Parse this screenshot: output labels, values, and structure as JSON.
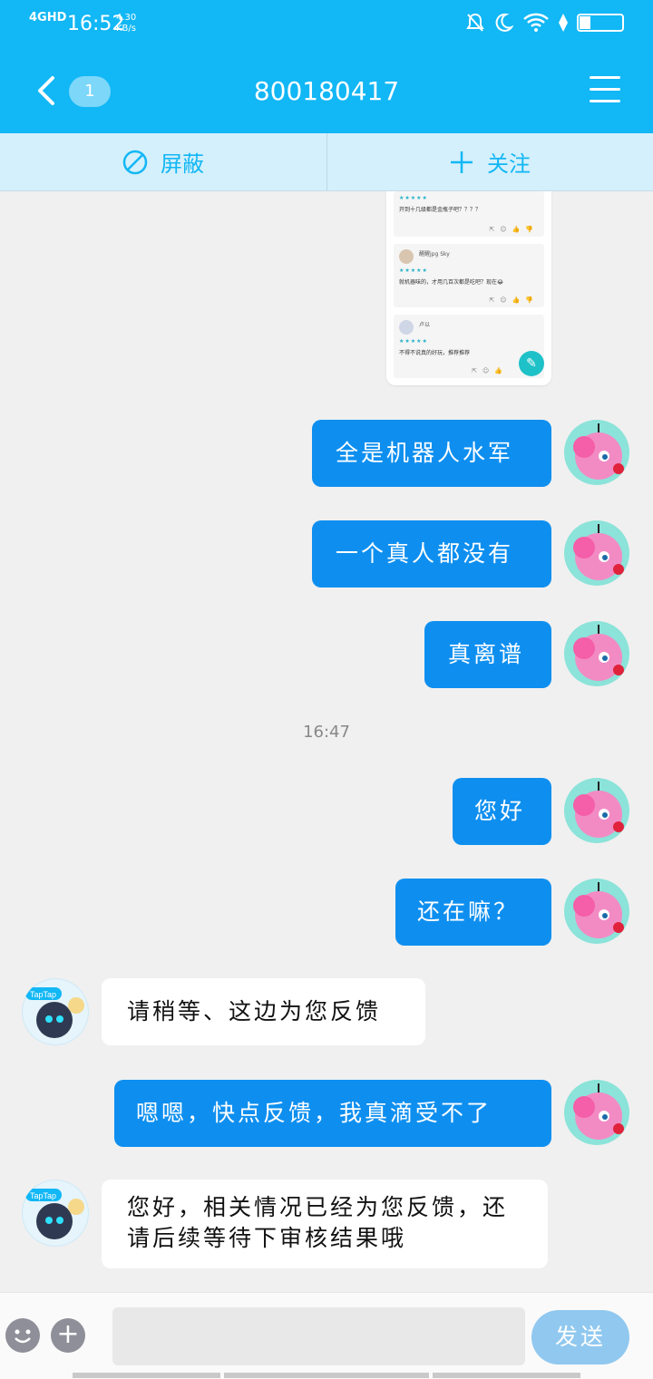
{
  "status": {
    "network": "4GHD",
    "time": "16:52",
    "speed_value": "4.30",
    "speed_unit": "KB/s",
    "battery": "27"
  },
  "header": {
    "title": "800180417",
    "unread_count": "1"
  },
  "actions": {
    "block_label": "屏蔽",
    "follow_label": "关注"
  },
  "screenshot_preview": {
    "cards": [
      {
        "name": "",
        "stars": "★★★★★",
        "text": "开到十几级都是金瓶子吧？？？？"
      },
      {
        "name": "醒醒jpg Sky",
        "stars": "★★★★★",
        "text": "就机器味的，才用几百次都是吃吧？现在😂"
      },
      {
        "name": "卢以",
        "stars": "★★★★★",
        "text": "不得不说真的好玩，推荐推荐"
      }
    ]
  },
  "messages": [
    {
      "side": "me",
      "text": "全是机器人水军"
    },
    {
      "side": "me",
      "text": "一个真人都没有"
    },
    {
      "side": "me",
      "text": "真离谱"
    },
    {
      "side": "time",
      "text": "16:47"
    },
    {
      "side": "me",
      "text": "您好"
    },
    {
      "side": "me",
      "text": "还在嘛？"
    },
    {
      "side": "other",
      "text": "请稍等、这边为您反馈"
    },
    {
      "side": "me",
      "text": "嗯嗯，快点反馈，我真滴受不了"
    },
    {
      "side": "other",
      "text": "您好，相关情况已经为您反馈，还请后续等待下审核结果哦"
    }
  ],
  "input": {
    "placeholder": "",
    "send_label": "发送"
  },
  "colors": {
    "brand": "#12b7f5",
    "my_bubble": "#0e8ff0",
    "send_disabled": "#90c8ef"
  },
  "icons": {
    "back": "back-arrow-icon",
    "menu": "menu-icon",
    "block": "block-icon",
    "follow": "plus-icon",
    "emoji": "emoji-icon",
    "more": "plus-circle-icon"
  }
}
